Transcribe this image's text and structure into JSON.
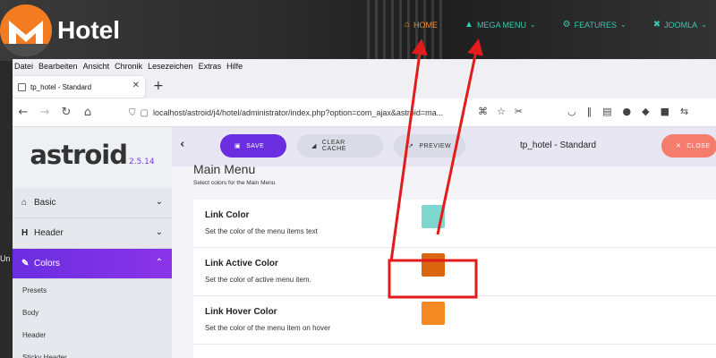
{
  "site": {
    "logo_text": "Hotel",
    "nav": [
      {
        "label": "HOME",
        "icon": "home-icon",
        "chevron": ""
      },
      {
        "label": "MEGA MENU",
        "icon": "mountain-icon",
        "chevron": "⌄"
      },
      {
        "label": "FEATURES",
        "icon": "gear-icon",
        "chevron": "⌄"
      },
      {
        "label": "JOOMLA",
        "icon": "joomla-icon",
        "chevron": "⌄"
      }
    ],
    "left_text": "Un"
  },
  "browser": {
    "menu": [
      "Datei",
      "Bearbeiten",
      "Ansicht",
      "Chronik",
      "Lesezeichen",
      "Extras",
      "Hilfe"
    ],
    "tab_title": "tp_hotel - Standard",
    "url": "localhost/astroid/j4/hotel/administrator/index.php?option=com_ajax&astroid=ma..."
  },
  "astroid": {
    "brand": "astroid",
    "version": "2.5.14",
    "sidebar": [
      {
        "label": "Basic",
        "icon": "home-icon",
        "chevron": "⌄"
      },
      {
        "label": "Header",
        "icon": "header-icon",
        "chevron": "⌄"
      },
      {
        "label": "Colors",
        "icon": "brush-icon",
        "chevron": "⌃"
      }
    ],
    "sub_items": [
      "Presets",
      "Body",
      "Header",
      "Sticky Header"
    ],
    "toolbar": {
      "save": "SAVE",
      "clear_cache": "CLEAR CACHE",
      "preview": "PREVIEW",
      "close": "CLOSE",
      "title": "tp_hotel - Standard"
    },
    "section": {
      "title": "Main Menu",
      "subtitle": "Select colors for the Main Menu"
    },
    "rows": [
      {
        "label": "Link Color",
        "desc": "Set the color of the menu items text",
        "color": "#7fd8cf"
      },
      {
        "label": "Link Active Color",
        "desc": "Set the color of active menu item.",
        "color": "#d9650f"
      },
      {
        "label": "Link Hover Color",
        "desc": "Set the color of the menu item on hover",
        "color": "#f58a24"
      }
    ]
  },
  "colors": {
    "accent": "#6a2ee0",
    "annotation": "#e21b1b",
    "site_nav_active": "#f08b2e",
    "site_nav": "#38c9b0"
  }
}
